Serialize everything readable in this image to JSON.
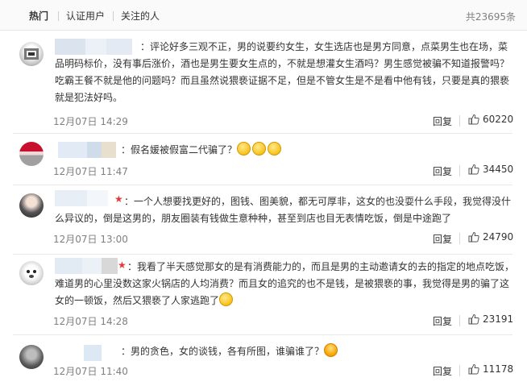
{
  "tabs": {
    "hot": "热门",
    "verified": "认证用户",
    "following": "关注的人",
    "total": "共23695条"
  },
  "comments": [
    {
      "text": "：评论好多三观不正，男的说要约女生，女生选店也是男方同意，点菜男生也在场，菜品明码标价，没有事后涨价，酒也是男生要女生点的，不就是想灌女生酒吗？男生感觉被骗不知道报警吗？吃霸王餐不就是他的问题吗？而且虽然说猥亵证据不足，但是不管女生是不是看中他有钱，只要是真的猥亵就是犯法好吗。",
      "time": "12月07日 14:29",
      "reply": "回复",
      "likes": "60220"
    },
    {
      "text": "：假名媛被假富二代骗了？",
      "time": "12月07日 11:47",
      "reply": "回复",
      "likes": "34450"
    },
    {
      "text": "：一个人想要找更好的，图钱、图美貌，都无可厚非，这女的也没耍什么手段，我觉得没什么异议的，倒是这男的，朋友圈装有钱做生意种种，甚至到店也目无表情吃饭，倒是中途跑了",
      "time": "12月07日 13:00",
      "reply": "回复",
      "likes": "24790"
    },
    {
      "text": "：我看了半天感觉那女的是有消费能力的，而且是男的主动邀请女的去的指定的地点吃饭，难道男的心里没数这家火锅店的人均消费？而且女的追究的也不是钱，是被猥亵的事，我觉得是男的骗了这女的一顿饭，然后又猥亵了人家逃跑了",
      "time": "12月07日 14:28",
      "reply": "回复",
      "likes": "23191"
    },
    {
      "text": "：男的贪色，女的谈钱，各有所图，谁骗谁了？",
      "time": "12月07日 11:40",
      "reply": "回复",
      "likes": "11178"
    }
  ],
  "star_glyph": "★",
  "colors": {
    "star": "#e4393c",
    "blur_blue": "#dbe8f5",
    "muted": "#808080"
  }
}
